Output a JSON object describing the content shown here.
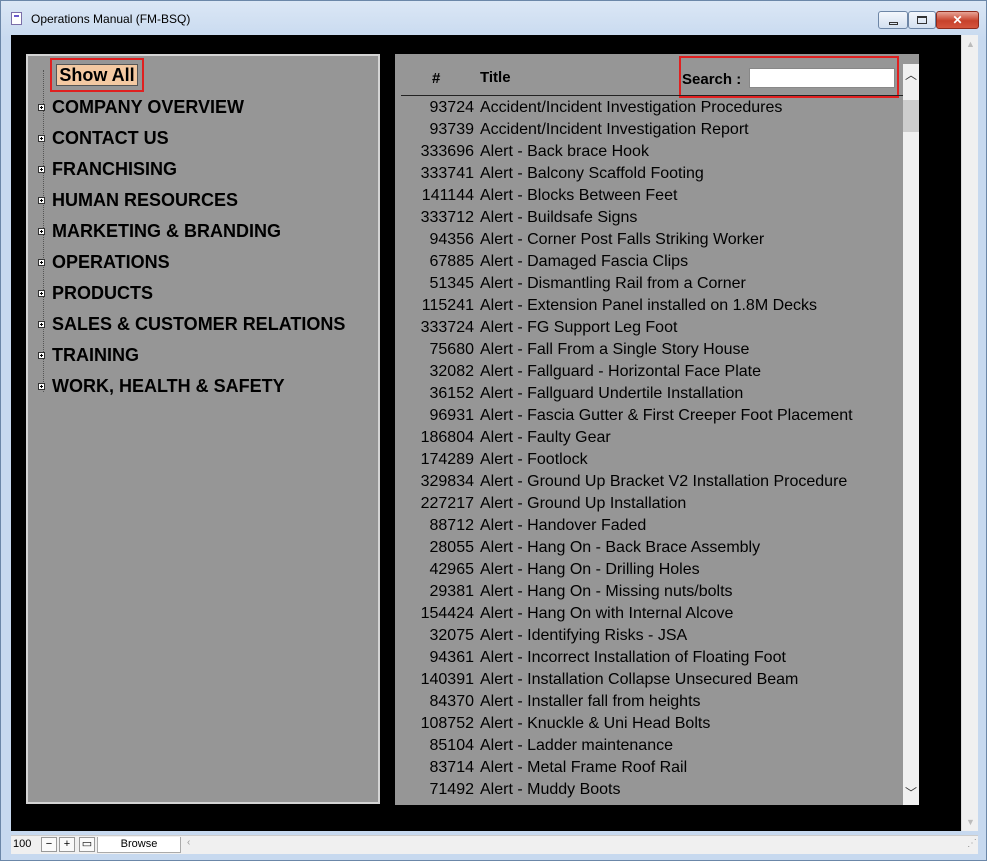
{
  "window": {
    "title": "Operations Manual (FM-BSQ)"
  },
  "controls": {
    "minimize": "",
    "maximize": "",
    "close": "✕"
  },
  "sidebar": {
    "show_all_label": "Show All",
    "items": [
      {
        "label": "COMPANY OVERVIEW"
      },
      {
        "label": "CONTACT US"
      },
      {
        "label": "FRANCHISING"
      },
      {
        "label": "HUMAN RESOURCES"
      },
      {
        "label": "MARKETING & BRANDING"
      },
      {
        "label": "OPERATIONS"
      },
      {
        "label": "PRODUCTS"
      },
      {
        "label": "SALES & CUSTOMER RELATIONS"
      },
      {
        "label": "TRAINING"
      },
      {
        "label": "WORK, HEALTH & SAFETY"
      }
    ]
  },
  "list": {
    "col_number": "#",
    "col_title": "Title",
    "search_label": "Search :",
    "search_value": "",
    "rows": [
      {
        "num": "93724",
        "title": "Accident/Incident Investigation Procedures"
      },
      {
        "num": "93739",
        "title": "Accident/Incident Investigation Report"
      },
      {
        "num": "333696",
        "title": "Alert - Back brace Hook"
      },
      {
        "num": "333741",
        "title": "Alert - Balcony Scaffold Footing"
      },
      {
        "num": "141144",
        "title": "Alert - Blocks Between Feet"
      },
      {
        "num": "333712",
        "title": "Alert - Buildsafe Signs"
      },
      {
        "num": "94356",
        "title": "Alert - Corner Post Falls Striking Worker"
      },
      {
        "num": "67885",
        "title": "Alert - Damaged Fascia Clips"
      },
      {
        "num": "51345",
        "title": "Alert - Dismantling Rail from a Corner"
      },
      {
        "num": "115241",
        "title": "Alert - Extension Panel installed on 1.8M Decks"
      },
      {
        "num": "333724",
        "title": "Alert - FG Support Leg Foot"
      },
      {
        "num": "75680",
        "title": "Alert - Fall From a Single Story House"
      },
      {
        "num": "32082",
        "title": "Alert - Fallguard - Horizontal Face Plate"
      },
      {
        "num": "36152",
        "title": "Alert - Fallguard Undertile Installation"
      },
      {
        "num": "96931",
        "title": "Alert - Fascia Gutter & First Creeper Foot Placement"
      },
      {
        "num": "186804",
        "title": "Alert - Faulty Gear"
      },
      {
        "num": "174289",
        "title": "Alert - Footlock"
      },
      {
        "num": "329834",
        "title": "Alert - Ground Up Bracket V2 Installation Procedure"
      },
      {
        "num": "227217",
        "title": "Alert - Ground Up Installation"
      },
      {
        "num": "88712",
        "title": "Alert - Handover Faded"
      },
      {
        "num": "28055",
        "title": "Alert - Hang On - Back Brace Assembly"
      },
      {
        "num": "42965",
        "title": "Alert - Hang On - Drilling Holes"
      },
      {
        "num": "29381",
        "title": "Alert - Hang On - Missing nuts/bolts"
      },
      {
        "num": "154424",
        "title": "Alert - Hang On with Internal Alcove"
      },
      {
        "num": "32075",
        "title": "Alert - Identifying Risks - JSA"
      },
      {
        "num": "94361",
        "title": "Alert - Incorrect Installation of Floating Foot"
      },
      {
        "num": "140391",
        "title": "Alert - Installation Collapse Unsecured Beam"
      },
      {
        "num": "84370",
        "title": "Alert - Installer fall from heights"
      },
      {
        "num": "108752",
        "title": "Alert - Knuckle & Uni Head Bolts"
      },
      {
        "num": "85104",
        "title": "Alert - Ladder maintenance"
      },
      {
        "num": "83714",
        "title": "Alert - Metal Frame Roof Rail"
      },
      {
        "num": "71492",
        "title": "Alert - Muddy Boots"
      }
    ]
  },
  "statusbar": {
    "zoom": "100",
    "zoom_out": "−",
    "zoom_in": "+",
    "mode": "Browse"
  }
}
